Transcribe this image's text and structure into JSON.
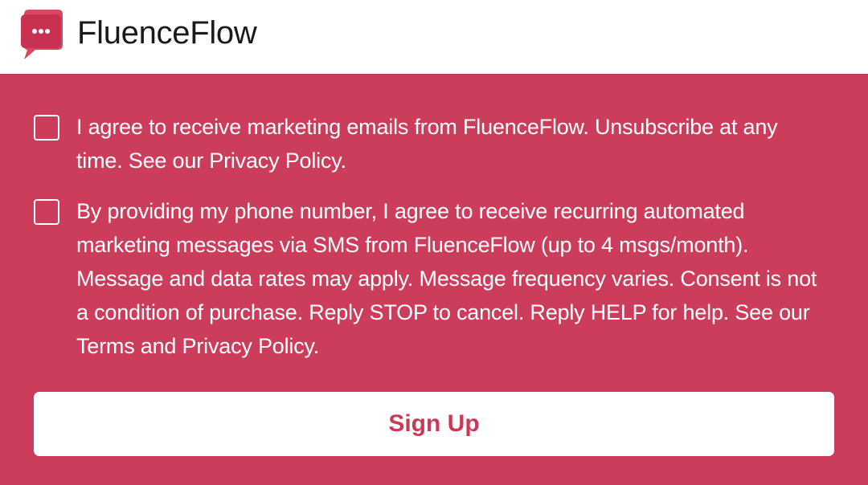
{
  "brand": {
    "name": "FluenceFlow",
    "logo_icon": "chat-bubble-dots-icon"
  },
  "colors": {
    "accent": "#cc3d5b",
    "button_text": "#c93a58",
    "panel_text": "#ffffff"
  },
  "consent": {
    "email": {
      "text": "I agree to receive marketing emails from FluenceFlow. Unsubscribe at any time. See our Privacy Policy.",
      "checked": false
    },
    "sms": {
      "text": "By providing my phone number, I agree to receive recurring automated marketing messages via SMS from FluenceFlow (up to 4 msgs/month). Message and data rates may apply. Message frequency varies. Consent is not a condition of purchase. Reply STOP to cancel. Reply HELP for help. See our Terms and Privacy Policy.",
      "checked": false
    }
  },
  "signup": {
    "label": "Sign Up"
  }
}
